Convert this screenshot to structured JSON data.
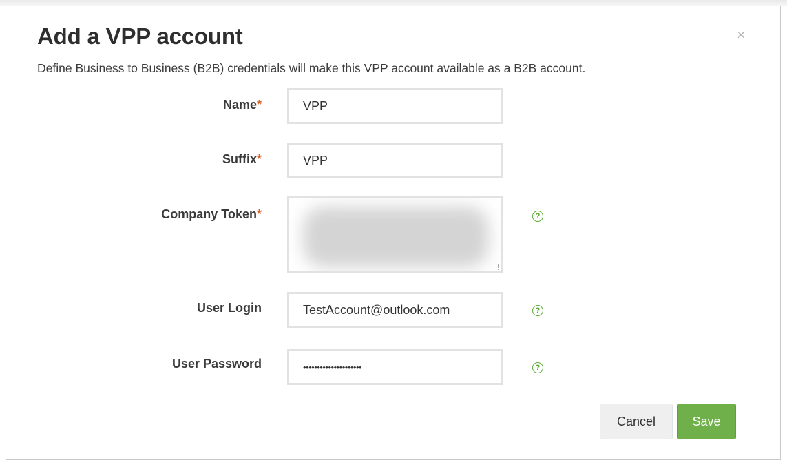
{
  "dialog": {
    "title": "Add a VPP account",
    "close_glyph": "×",
    "description": "Define Business to Business (B2B) credentials will make this VPP account available as a B2B account."
  },
  "form": {
    "required_marker": "*",
    "name": {
      "label": "Name",
      "value": "VPP"
    },
    "suffix": {
      "label": "Suffix",
      "value": "VPP"
    },
    "company_token": {
      "label": "Company Token"
    },
    "user_login": {
      "label": "User Login",
      "value": "TestAccount@outlook.com"
    },
    "user_password": {
      "label": "User Password",
      "value": "•••••••••••••••••••••"
    },
    "help_glyph": "?"
  },
  "buttons": {
    "cancel": "Cancel",
    "save": "Save"
  },
  "colors": {
    "accent_green": "#6fb04a",
    "required_orange": "#e0602a"
  }
}
